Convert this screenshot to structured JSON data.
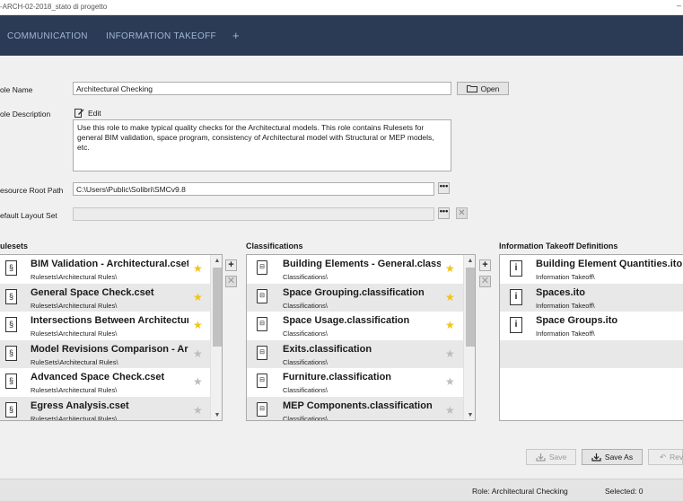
{
  "window": {
    "title": "-ARCH-02-2018_stato di progetto",
    "minimize": "–"
  },
  "nav": {
    "tabs": [
      "COMMUNICATION",
      "INFORMATION TAKEOFF"
    ],
    "add": "+"
  },
  "form": {
    "role_name_label": "ole Name",
    "role_name_value": "Architectural Checking",
    "open_label": "Open",
    "role_desc_label": "ole Description",
    "edit_label": "Edit",
    "description": "Use this role to make typical quality checks for the Architectural models. This role contains Rulesets for general BIM validation, space program, consistency of Architectural model with Structural or MEP models, etc.",
    "resource_root_label": "esource Root Path",
    "resource_root_value": "C:\\Users\\Public\\Solibri\\SMCv9.8",
    "default_layout_label": "efault Layout Set",
    "default_layout_value": "",
    "browse": "•••",
    "clear": "✕"
  },
  "rulesets": {
    "title": "ulesets",
    "add": "+",
    "remove": "✕",
    "items": [
      {
        "name": "BIM Validation - Architectural.cset",
        "path": "Rulesets\\Architectural Rules\\",
        "favorite": true
      },
      {
        "name": "General Space Check.cset",
        "path": "Rulesets\\Architectural Rules\\",
        "favorite": true
      },
      {
        "name": "Intersections Between Architectural Components.cset",
        "path": "Rulesets\\Architectural Rules\\",
        "favorite": true
      },
      {
        "name": "Model Revisions Comparison - Architectural.cset",
        "path": "RuleSets\\Architectural Rules\\",
        "favorite": false
      },
      {
        "name": "Advanced Space Check.cset",
        "path": "Rulesets\\Architectural Rules\\",
        "favorite": false
      },
      {
        "name": "Egress Analysis.cset",
        "path": "Rulesets\\Architectural Rules\\",
        "favorite": false
      }
    ]
  },
  "classifications": {
    "title": "Classifications",
    "add": "+",
    "remove": "✕",
    "items": [
      {
        "name": "Building Elements - General.classification",
        "path": "Classifications\\",
        "favorite": true
      },
      {
        "name": "Space Grouping.classification",
        "path": "Classifications\\",
        "favorite": true
      },
      {
        "name": "Space Usage.classification",
        "path": "Classifications\\",
        "favorite": true
      },
      {
        "name": "Exits.classification",
        "path": "Classifications\\",
        "favorite": false
      },
      {
        "name": "Furniture.classification",
        "path": "Classifications\\",
        "favorite": false
      },
      {
        "name": "MEP Components.classification",
        "path": "Classifications\\",
        "favorite": false
      }
    ]
  },
  "takeoff": {
    "title": "Information Takeoff Definitions",
    "items": [
      {
        "name": "Building Element Quantities.ito",
        "path": "Information Takeoff\\"
      },
      {
        "name": "Spaces.ito",
        "path": "Information Takeoff\\"
      },
      {
        "name": "Space Groups.ito",
        "path": "Information Takeoff\\"
      }
    ]
  },
  "actions": {
    "save": "Save",
    "save_as": "Save As",
    "revert": "Rev"
  },
  "status": {
    "role": "Role: Architectural Checking",
    "selected": "Selected: 0"
  },
  "colors": {
    "nav_bg": "#2b3a55",
    "nav_text": "#9fb6d3",
    "star_on": "#f0c419",
    "star_off": "#bdbdbd"
  },
  "icons": {
    "ruleset": "§",
    "classification": "⊟",
    "takeoff": "i",
    "star": "★",
    "up": "▲",
    "down": "▼"
  }
}
